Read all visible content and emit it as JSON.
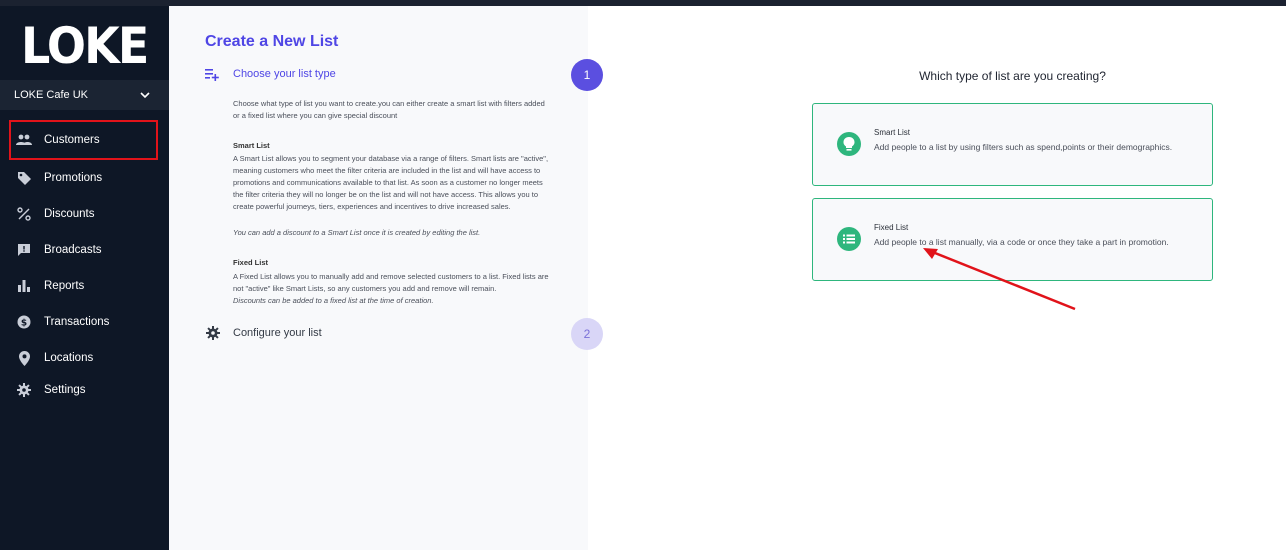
{
  "sidebar": {
    "logo": "LOKE",
    "store": "LOKE Cafe UK",
    "items": [
      {
        "label": "Customers",
        "icon": "people-icon"
      },
      {
        "label": "Promotions",
        "icon": "tag-icon"
      },
      {
        "label": "Discounts",
        "icon": "percent-icon"
      },
      {
        "label": "Broadcasts",
        "icon": "message-alert-icon"
      },
      {
        "label": "Reports",
        "icon": "bar-chart-icon"
      },
      {
        "label": "Transactions",
        "icon": "dollar-circle-icon"
      },
      {
        "label": "Locations",
        "icon": "location-pin-icon"
      },
      {
        "label": "Settings",
        "icon": "gear-icon"
      }
    ]
  },
  "wizard": {
    "title": "Create a New List",
    "step1": {
      "number": "1",
      "title": "Choose your list type",
      "intro": "Choose what type of list you want to create.you can either create a smart list with filters added or a fixed list where you can give special discount",
      "smart_heading": "Smart List",
      "smart_text": "A Smart List allows you to segment your database via a range of filters. Smart lists are \"active\", meaning customers who meet the filter criteria are included in the list and will have access to promotions and communications available to that list. As soon as a customer no longer meets the filter criteria they will no longer be on the list and will not have access. This allows you to create powerful journeys, tiers, experiences and incentives to drive increased sales.",
      "smart_note": "You can add a discount to a Smart List once it is created by editing the list.",
      "fixed_heading": "Fixed List",
      "fixed_text": "A Fixed List allows you to manually add and remove selected customers to a list. Fixed lists are not \"active\" like Smart Lists, so any customers you add and remove will remain.",
      "fixed_note": "Discounts can be added to a fixed list at the time of creation."
    },
    "step2": {
      "number": "2",
      "title": "Configure your list"
    }
  },
  "chooser": {
    "question": "Which type of list are you creating?",
    "options": [
      {
        "title": "Smart List",
        "description": "Add people to a list by using filters such as spend,points or their demographics.",
        "icon": "lightbulb-icon"
      },
      {
        "title": "Fixed List",
        "description": "Add people to a list manually, via a code or once they take a part in promotion.",
        "icon": "list-icon"
      }
    ]
  },
  "colors": {
    "sidebar_bg": "#0e1726",
    "accent": "#4f46e5",
    "green": "#2eb67d",
    "highlight_red": "#e1131a"
  }
}
